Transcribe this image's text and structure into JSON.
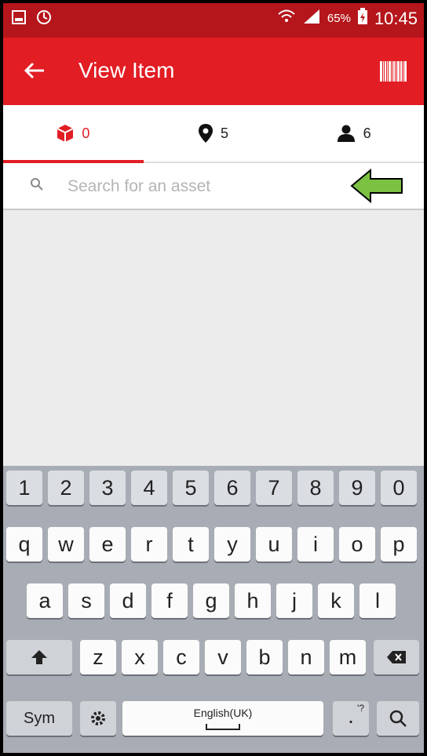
{
  "status_bar": {
    "battery": "65%",
    "time": "10:45",
    "icons": [
      "screenshot-icon",
      "sync-icon",
      "wifi-icon",
      "signal-icon",
      "battery-charging-icon"
    ]
  },
  "app_bar": {
    "title": "View Item",
    "back_icon": "arrow-left-icon",
    "action_icon": "barcode-icon",
    "color": "#e21d24"
  },
  "tabs": [
    {
      "icon": "package-icon",
      "count": "0",
      "active": true
    },
    {
      "icon": "location-pin-icon",
      "count": "5",
      "active": false
    },
    {
      "icon": "person-icon",
      "count": "6",
      "active": false
    }
  ],
  "search": {
    "placeholder": "Search for an asset",
    "value": ""
  },
  "annotation": {
    "icon": "green-arrow-icon",
    "color": "#7cc142"
  },
  "keyboard": {
    "row_numbers": [
      "1",
      "2",
      "3",
      "4",
      "5",
      "6",
      "7",
      "8",
      "9",
      "0"
    ],
    "row1": [
      "q",
      "w",
      "e",
      "r",
      "t",
      "y",
      "u",
      "i",
      "o",
      "p"
    ],
    "row2": [
      "a",
      "s",
      "d",
      "f",
      "g",
      "h",
      "j",
      "k",
      "l"
    ],
    "row3": [
      "z",
      "x",
      "c",
      "v",
      "b",
      "n",
      "m"
    ],
    "sym_label": "Sym",
    "space_label": "English(UK)",
    "punct_label": "'?",
    "punct_main": "."
  }
}
